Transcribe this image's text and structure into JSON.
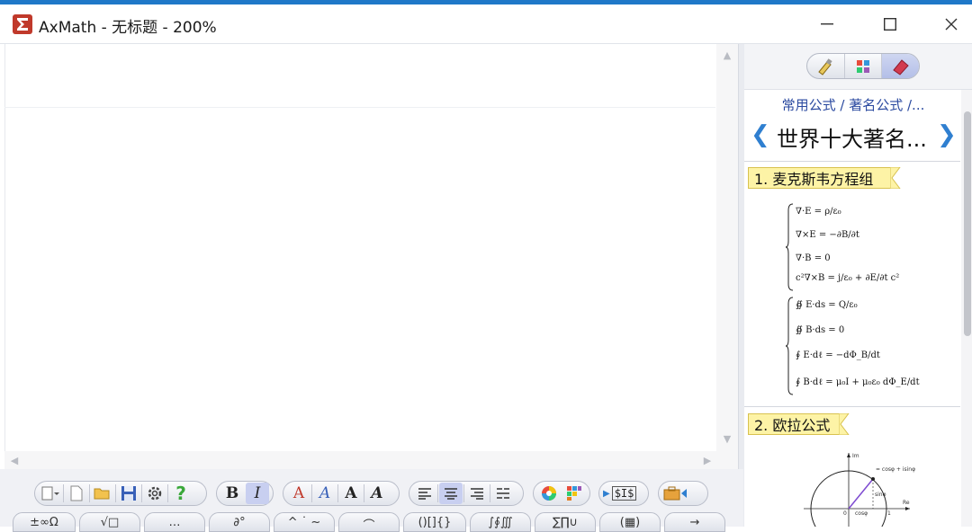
{
  "window": {
    "title": "AxMath - 无标题 - 200%",
    "minimize_label": "minimize",
    "maximize_label": "maximize",
    "close_label": "close"
  },
  "toolbar": {
    "groups": [
      {
        "name": "file",
        "buttons": [
          "new-menu-icon",
          "new-doc-icon",
          "open-folder-icon",
          "save-icon",
          "settings-gear-icon",
          "help-icon"
        ]
      },
      {
        "name": "font-style",
        "buttons": [
          "B",
          "I"
        ]
      },
      {
        "name": "text-style",
        "buttons": [
          "A",
          "A",
          "A",
          "A"
        ]
      },
      {
        "name": "align",
        "buttons": [
          "align-left-icon",
          "align-center-icon",
          "align-right-icon",
          "align-distribute-icon"
        ]
      },
      {
        "name": "color",
        "buttons": [
          "color-wheel-icon",
          "color-grid-icon"
        ]
      },
      {
        "name": "latex",
        "buttons": [
          "$I$"
        ]
      },
      {
        "name": "toolbox",
        "buttons": [
          "toolbox-icon"
        ]
      }
    ],
    "active": [
      "I",
      "align-center-icon"
    ],
    "symbol_tabs": [
      "±∞Ω",
      "√□",
      "…",
      "∂°",
      "^ ˙ ~",
      "⌒",
      "()[]{}",
      "∫∮∭",
      "∑∏∪",
      "(▦)",
      "→"
    ]
  },
  "panel": {
    "modes": [
      "brush-icon",
      "grid-icon",
      "eraser-icon"
    ],
    "active_mode": "eraser-icon",
    "breadcrumb": "常用公式 / 著名公式 /...",
    "page_title": "世界十大著名...",
    "sections": [
      {
        "label": "1. 麦克斯韦方程组"
      },
      {
        "label": "2. 欧拉公式"
      }
    ],
    "maxwell_differential": [
      "∇·E = ρ/ε₀",
      "∇×E = −∂B/∂t",
      "∇·B = 0",
      "c²∇×B = j/ε₀ + ∂E/∂t c²"
    ],
    "maxwell_integral": [
      "∯ E·ds = Q/ε₀",
      "∯ B·ds = 0",
      "∮ E·dℓ = −dΦ_B/dt",
      "∮ B·dℓ = μ₀I + μ₀ε₀ dΦ_E/dt"
    ],
    "euler_figure": {
      "axis_y": "Im",
      "axis_x": "Re",
      "label_top": "= cosφ + isinφ",
      "label_sin": "sinφ",
      "label_cos": "cosφ",
      "label_one": "1",
      "label_origin": "0"
    }
  },
  "colors": {
    "accent": "#2f7fd0",
    "section_bg": "#fdf3a6",
    "window_strip": "#1f78c8"
  }
}
